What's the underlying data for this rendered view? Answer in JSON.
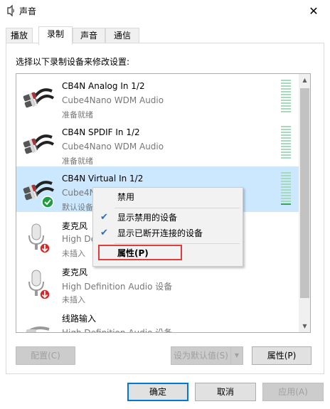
{
  "window": {
    "title": "声音",
    "close_glyph": "✕"
  },
  "tabs": [
    {
      "label": "播放",
      "active": false
    },
    {
      "label": "录制",
      "active": true
    },
    {
      "label": "声音",
      "active": false
    },
    {
      "label": "通信",
      "active": false
    }
  ],
  "instruction": "选择以下录制设备来修改设置:",
  "devices": [
    {
      "name": "CB4N Analog In 1/2",
      "driver": "Cube4Nano WDM Audio",
      "status": "准备就绪",
      "icon": "rca-cable-icon",
      "selected": false,
      "level": 0
    },
    {
      "name": "CB4N SPDIF In 1/2",
      "driver": "Cube4Nano WDM Audio",
      "status": "准备就绪",
      "icon": "rca-cable-icon",
      "selected": false,
      "level": 0
    },
    {
      "name": "CB4N Virtual In 1/2",
      "driver": "Cube4N",
      "status": "默认设备",
      "icon": "rca-cable-icon",
      "selected": true,
      "level": 0.1,
      "badge": "default-check-icon"
    },
    {
      "name": "麦克风",
      "driver": "High De",
      "status": "未插入",
      "icon": "microphone-icon",
      "selected": false,
      "badge": "unplugged-icon"
    },
    {
      "name": "麦克风",
      "driver": "High Definition Audio 设备",
      "status": "未插入",
      "icon": "microphone-icon",
      "selected": false,
      "badge": "unplugged-icon"
    },
    {
      "name": "线路输入",
      "driver": "High Definition Audio 设备",
      "status": "",
      "icon": "line-in-icon",
      "selected": false
    }
  ],
  "context_menu": {
    "disable_label": "禁用",
    "show_disabled_label": "显示禁用的设备",
    "show_disconnected_label": "显示已断开连接的设备",
    "properties_label": "属性(P)",
    "check_glyph": "✔"
  },
  "buttons": {
    "configure": "配置(C)",
    "set_default": "设为默认值(S)",
    "properties": "属性(P)",
    "ok": "确定",
    "cancel": "取消",
    "apply": "应用(A)"
  },
  "colors": {
    "selection": "#cce8ff",
    "highlight_border": "#e03c3c",
    "level_meter": "#a7d9bc",
    "level_meter_active": "#3aa655",
    "default_check": "#1e9e3e",
    "unplugged": "#d42a2a"
  }
}
